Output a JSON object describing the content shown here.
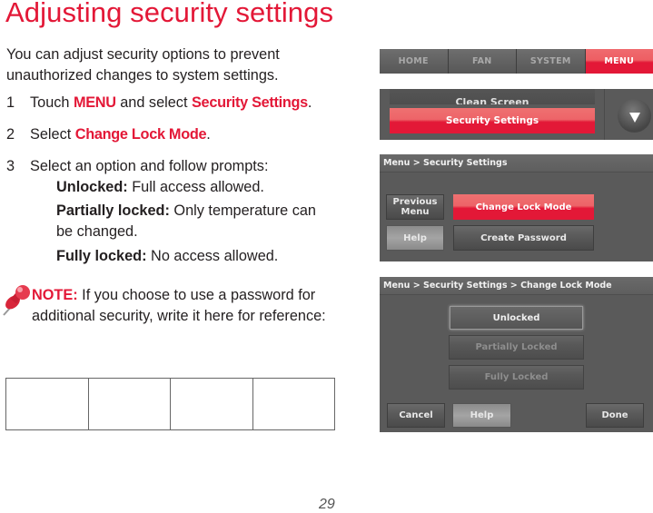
{
  "page": {
    "title": "Adjusting security settings",
    "intro": "You can adjust security options to prevent unauthorized changes to system settings.",
    "steps": [
      {
        "num": "1",
        "pre": "Touch ",
        "hl1": "MENU",
        "mid": " and select ",
        "hl2": "Security Settings",
        "post": "."
      },
      {
        "num": "2",
        "pre": "Select ",
        "hl1": "Change Lock Mode",
        "post": "."
      },
      {
        "num": "3",
        "text": "Select an option and follow prompts:"
      }
    ],
    "options": [
      {
        "label": "Unlocked:",
        "desc": " Full access allowed."
      },
      {
        "label": "Partially locked:",
        "desc": " Only temperature can be changed."
      },
      {
        "label": "Fully locked:",
        "desc": " No access allowed."
      }
    ],
    "note": {
      "icon": "pushpin-icon",
      "label": "NOTE:",
      "text": " If you choose to use a password for additional security, write it here for reference:"
    },
    "password_boxes": 4,
    "page_number": "29",
    "accent_color": "#e31837"
  },
  "screens": {
    "nav": {
      "tabs": [
        "HOME",
        "FAN",
        "SYSTEM",
        "MENU"
      ],
      "active": "MENU"
    },
    "menu_list": {
      "partial_item": "Clean Screen",
      "selected_item": "Security Settings",
      "scroll_icon": "down-arrow-icon"
    },
    "security_settings": {
      "breadcrumb": "Menu > Security Settings",
      "previous_menu": "Previous Menu",
      "change_lock_mode": "Change Lock Mode",
      "help": "Help",
      "create_password": "Create Password"
    },
    "change_lock_mode": {
      "breadcrumb": "Menu > Security Settings > Change Lock Mode",
      "options": [
        "Unlocked",
        "Partially Locked",
        "Fully Locked"
      ],
      "selected": "Unlocked",
      "cancel": "Cancel",
      "help": "Help",
      "done": "Done"
    }
  }
}
